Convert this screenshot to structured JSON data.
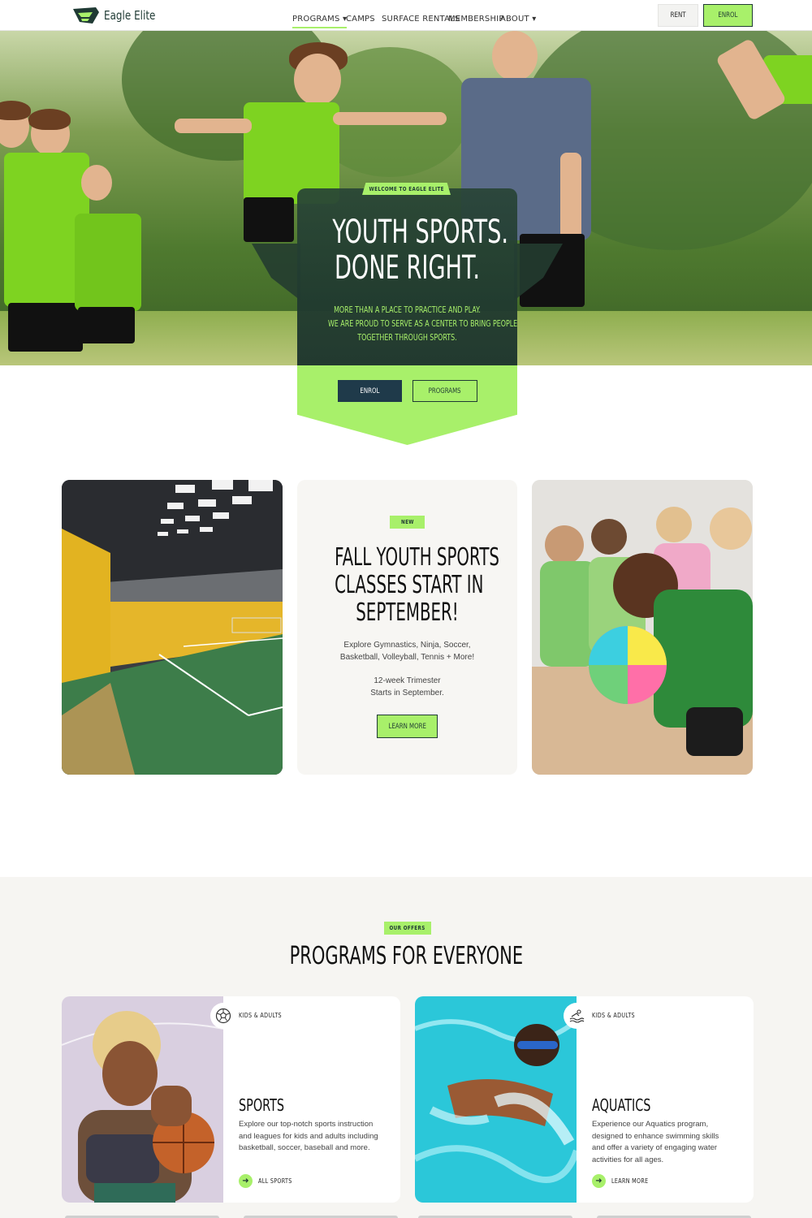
{
  "brand": {
    "name": "Eagle Elite",
    "accent": "#a8f06a",
    "dark": "#1f3a34"
  },
  "nav": {
    "links": [
      {
        "label": "Programs",
        "dropdown": true,
        "active": true
      },
      {
        "label": "Camps",
        "dropdown": false
      },
      {
        "label": "Surface Rentals",
        "dropdown": false
      },
      {
        "label": "Membership",
        "dropdown": false
      },
      {
        "label": "About",
        "dropdown": true
      }
    ],
    "rent_label": "Rent",
    "enrol_label": "Enrol",
    "dropdown_glyph": "▾"
  },
  "hero": {
    "tag": "Welcome to Eagle Elite",
    "title_line1": "Youth Sports.",
    "title_line2": "Done Right.",
    "sub_line1": "More than a place to practice and play.",
    "sub_line2": "We are proud to serve as a center to bring people",
    "sub_line3": "together through sports.",
    "enrol_label": "Enrol",
    "programs_label": "Programs"
  },
  "feature": {
    "badge": "New",
    "title_line1": "Fall Youth Sports",
    "title_line2": "Classes Start In",
    "title_line3": "September!",
    "desc_line1": "Explore Gymnastics, Ninja, Soccer,",
    "desc_line2": "Basketball, Volleyball, Tennis + More!",
    "info_line1": "12-week Trimester",
    "info_line2": "Starts in September.",
    "button_label": "Learn More"
  },
  "programs": {
    "badge": "Our Offers",
    "heading": "Programs For Everyone",
    "cards": [
      {
        "tag": "Kids & Adults",
        "icon": "soccer-ball-icon",
        "title": "Sports",
        "desc": "Explore our top-notch sports instruction and leagues for kids and adults including basketball, soccer, baseball and more.",
        "link": "All Sports"
      },
      {
        "tag": "Kids & Adults",
        "icon": "swimmer-icon",
        "title": "Aquatics",
        "desc": "Experience our Aquatics program, designed to enhance swimming skills and offer a variety of engaging water activities for all ages.",
        "link": "Learn More"
      }
    ]
  }
}
